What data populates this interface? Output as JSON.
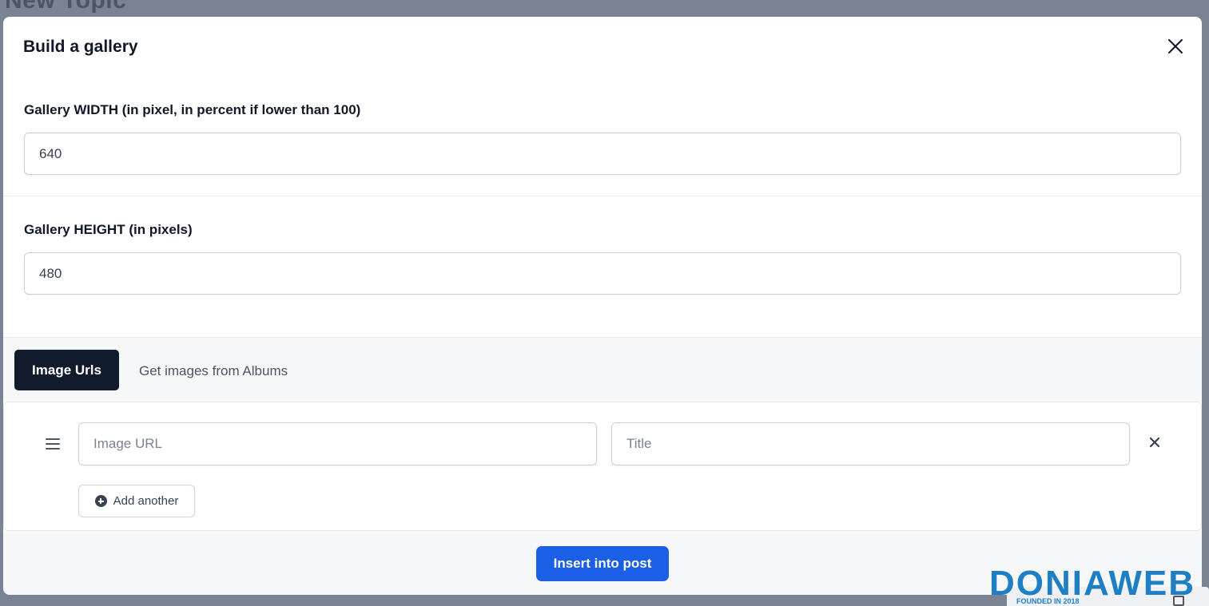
{
  "background": {
    "page_title": "New Topic"
  },
  "modal": {
    "title": "Build a gallery",
    "width_field": {
      "label": "Gallery WIDTH (in pixel, in percent if lower than 100)",
      "value": "640"
    },
    "height_field": {
      "label": "Gallery HEIGHT (in pixels)",
      "value": "480"
    },
    "tabs": [
      {
        "label": "Image Urls",
        "active": true
      },
      {
        "label": "Get images from Albums",
        "active": false
      }
    ],
    "image_row": {
      "url_placeholder": "Image URL",
      "title_placeholder": "Title"
    },
    "add_another_label": "Add another",
    "insert_label": "Insert into post"
  },
  "watermark": {
    "brand": "DONIAWEB",
    "tagline": "FOUNDED IN 2018"
  },
  "colors": {
    "primary": "#1a5fe6",
    "tab_active_bg": "#111b2e",
    "watermark_blue": "#1f7fc4"
  }
}
